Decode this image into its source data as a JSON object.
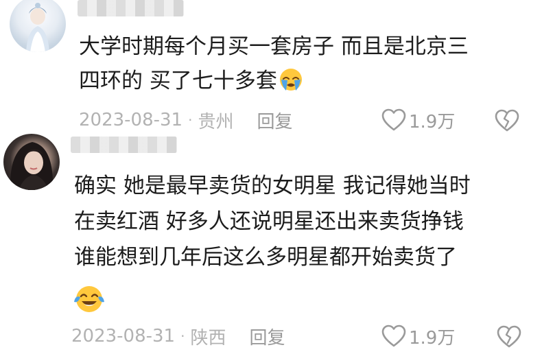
{
  "comments": [
    {
      "avatar_icon": "user-avatar-anime-girl",
      "username_masked": true,
      "text_lines": [
        "大学时期每个月买一套房子   而且是北京三",
        "四环的  买了七十多套"
      ],
      "emoji": "loudly-crying-face-icon",
      "date": "2023-08-31",
      "location": "贵州",
      "reply_label": "回复",
      "like_count": "1.9万"
    },
    {
      "avatar_icon": "user-avatar-photo-woman",
      "username_masked": true,
      "text_lines": [
        "确实  她是最早卖货的女明星  我记得她当时",
        "在卖红酒  好多人还说明星还出来卖货挣钱",
        "谁能想到几年后这么多明星都开始卖货了"
      ],
      "emoji": "face-with-tears-of-joy-icon",
      "date": "2023-08-31",
      "location": "陕西",
      "reply_label": "回复",
      "like_count": "1.9万"
    }
  ],
  "colors": {
    "text": "#1c1c1c",
    "meta": "#b2b2b2",
    "icon": "#9a9a9a",
    "emoji_yellow": "#ffc83d",
    "emoji_tear": "#4fa3e6"
  }
}
